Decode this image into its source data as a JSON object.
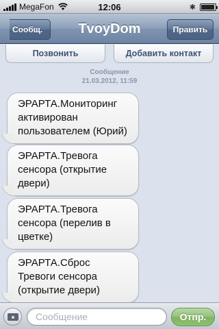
{
  "status_bar": {
    "carrier": "MegaFon",
    "time": "12:06",
    "signal_bars": 5,
    "battery_level": 0.95
  },
  "nav": {
    "back_label": "Сообщ.",
    "title": "TvoyDom",
    "edit_label": "Править"
  },
  "actions": {
    "call_label": "Позвонить",
    "add_contact_label": "Добавить контакт"
  },
  "conversation": {
    "header_label": "Сообщение",
    "timestamp": "21.03.2012, 11:59",
    "messages": [
      "ЭРАРТА.Мониторинг активирован пользователем (Юрий)",
      "ЭРАРТА.Тревога сенсора (открытие двери)",
      "ЭРАРТА.Тревога сенсора (перелив в цветке)",
      "ЭРАРТА.Сброс Тревоги сенсора (открытие двери)"
    ]
  },
  "input_bar": {
    "placeholder": "Сообщение",
    "value": "",
    "send_label": "Отпр."
  },
  "colors": {
    "nav_bar": "#7f94af",
    "background": "#dbe2ed",
    "send_button": "#8fc071"
  }
}
